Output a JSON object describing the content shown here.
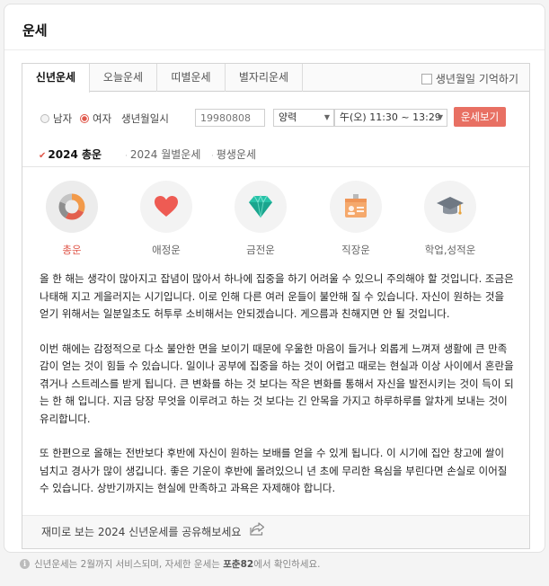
{
  "card": {
    "title": "운세"
  },
  "tabs": [
    {
      "label": "신년운세",
      "active": true
    },
    {
      "label": "오늘운세"
    },
    {
      "label": "띠별운세"
    },
    {
      "label": "별자리운세"
    }
  ],
  "remember_label": "생년월일 기억하기",
  "form": {
    "gender_male": "남자",
    "gender_female": "여자",
    "selected_gender": "여자",
    "birth_label": "생년월일시",
    "birth_placeholder": "19980808",
    "calendar_value": "양력",
    "time_value": "午(오) 11:30 ~ 13:29",
    "submit_label": "운세보기"
  },
  "subtabs": [
    {
      "label": "2024 총운",
      "active": true
    },
    {
      "label": "2024 월별운세"
    },
    {
      "label": "평생운세"
    }
  ],
  "categories": [
    {
      "label": "총운",
      "icon": "donut-chart-icon",
      "active": true
    },
    {
      "label": "애정운",
      "icon": "heart-icon"
    },
    {
      "label": "금전운",
      "icon": "gem-icon"
    },
    {
      "label": "직장운",
      "icon": "id-badge-icon"
    },
    {
      "label": "학업,성적운",
      "icon": "graduation-cap-icon"
    }
  ],
  "fortune_paragraphs": [
    "올 한 해는 생각이 많아지고 잡념이 많아서 하나에 집중을 하기 어려울 수 있으니 주의해야 할 것입니다. 조금은 나태해 지고 게을러지는 시기입니다. 이로 인해 다른 여러 운들이 불안해 질 수 있습니다. 자신이 원하는 것을 얻기 위해서는 일분일초도 허투루 소비해서는 안되겠습니다. 게으름과 친해지면 안 될 것입니다.",
    "이번 해에는 감정적으로 다소 불안한 면을 보이기 때문에 우울한 마음이 들거나 외롭게 느껴져 생활에 큰 만족감이 얻는 것이 힘들 수 있습니다. 일이나 공부에 집중을 하는 것이 어렵고 때로는 현실과 이상 사이에서 혼란을 겪거나 스트레스를 받게 됩니다. 큰 변화를 하는 것 보다는 작은 변화를 통해서 자신을 발전시키는 것이 득이 되는 한 해 입니다. 지금 당장 무엇을 이루려고 하는 것 보다는 긴 안목을 가지고 하루하루를 알차게 보내는 것이 유리합니다.",
    "또 한편으로 올해는 전반보다 후반에 자신이 원하는 보배를 얻을 수 있게 됩니다. 이 시기에 집안 창고에 쌀이 넘치고 경사가 많이 생깁니다. 좋은 기운이 후반에 몰려있으니 년 초에 무리한 욕심을 부린다면 손실로 이어질 수 있습니다. 상반기까지는 현실에 만족하고 과욕은 자제해야 합니다."
  ],
  "share": {
    "text": "재미로 보는 2024 신년운세를 공유해보세요"
  },
  "footnote": {
    "text_before": "신년운세는 2월까지 서비스되며, 자세한 운세는 ",
    "brand": "포춘82",
    "text_after": "에서 확인하세요."
  },
  "colors": {
    "accent": "#e0594c",
    "button": "#e87063"
  }
}
